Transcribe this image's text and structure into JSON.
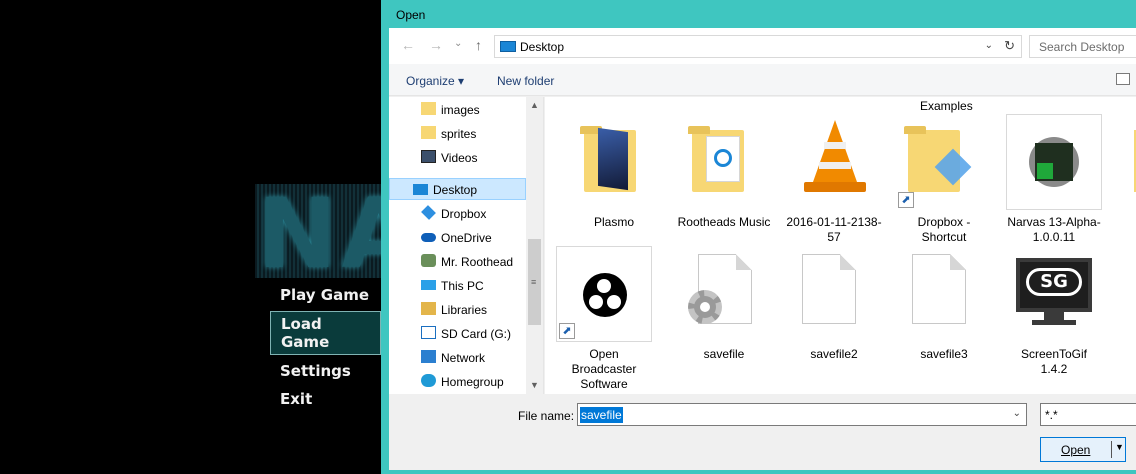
{
  "game": {
    "logo_text": "NAI",
    "menu": [
      {
        "label": "Play Game",
        "selected": false
      },
      {
        "label": "Load Game",
        "selected": true
      },
      {
        "label": "Settings",
        "selected": false
      },
      {
        "label": "Exit",
        "selected": false
      }
    ]
  },
  "dialog": {
    "title": "Open",
    "nav": {
      "back": "←",
      "forward": "→",
      "recent": "⌄",
      "up": "↑"
    },
    "address": {
      "location": "Desktop",
      "dropdown": "⌄",
      "refresh": "↻"
    },
    "search": {
      "placeholder": "Search Desktop"
    },
    "toolbar": {
      "organize": "Organize ▾",
      "new_folder": "New folder"
    },
    "nav_pane": [
      {
        "label": "images",
        "icon": "folder-icon"
      },
      {
        "label": "sprites",
        "icon": "folder-icon"
      },
      {
        "label": "Videos",
        "icon": "videos-icon"
      },
      {
        "label": "Desktop",
        "icon": "desktop-icon",
        "selected": true
      },
      {
        "label": "Dropbox",
        "icon": "dropbox-icon"
      },
      {
        "label": "OneDrive",
        "icon": "onedrive-icon"
      },
      {
        "label": "Mr. Roothead",
        "icon": "user-icon"
      },
      {
        "label": "This PC",
        "icon": "pc-icon"
      },
      {
        "label": "Libraries",
        "icon": "libraries-icon"
      },
      {
        "label": "SD Card (G:)",
        "icon": "sdcard-icon"
      },
      {
        "label": "Network",
        "icon": "network-icon"
      },
      {
        "label": "Homegroup",
        "icon": "homegroup-icon"
      }
    ],
    "scroll": {
      "up": "▲",
      "down": "▼",
      "grip": "≡"
    },
    "files_header": "Examples",
    "files": [
      {
        "name": "Plasmo",
        "kind": "folder"
      },
      {
        "name": "Rootheads Music",
        "kind": "folder"
      },
      {
        "name": "2016-01-11-2138-57",
        "kind": "vlc"
      },
      {
        "name": "Dropbox - Shortcut",
        "kind": "dropbox-shortcut"
      },
      {
        "name": "Narvas 13-Alpha-1.0.0.11",
        "kind": "app"
      },
      {
        "name": "Open Broadcaster Software",
        "kind": "obs-shortcut"
      },
      {
        "name": "savefile",
        "kind": "settings-file"
      },
      {
        "name": "savefile2",
        "kind": "file"
      },
      {
        "name": "savefile3",
        "kind": "file"
      },
      {
        "name": "ScreenToGif 1.4.2",
        "kind": "app"
      }
    ],
    "filename": {
      "label": "File name:",
      "value": "savefile",
      "dropdown": "⌄"
    },
    "filter": {
      "value": "*.*"
    },
    "open_button": {
      "label": "Open",
      "arrow": "▼"
    },
    "shortcut_arrow": "⬈",
    "colors": {
      "accent": "#3fc6c0",
      "selection": "#0078d7",
      "nav_selected": "#cce8ff"
    }
  }
}
